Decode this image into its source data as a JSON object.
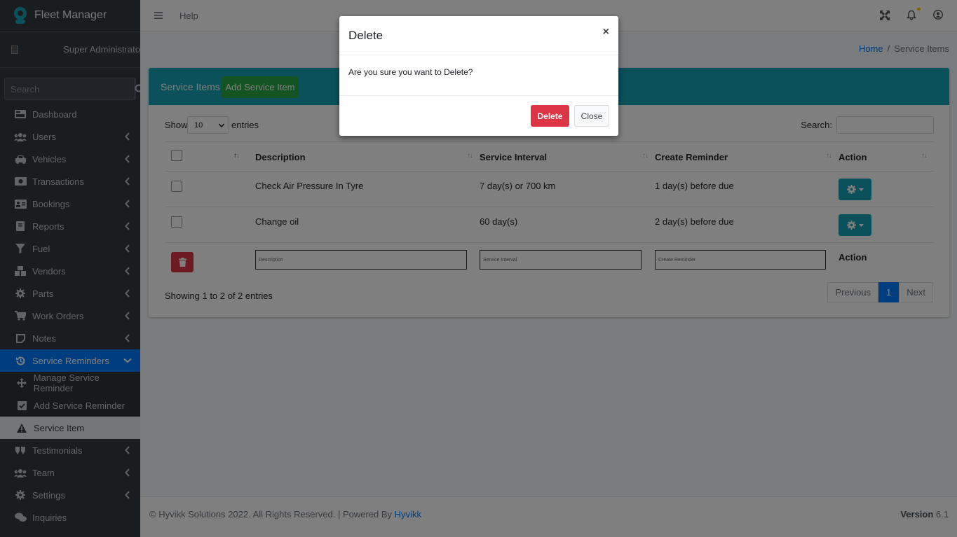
{
  "brand": {
    "title": "Fleet Manager"
  },
  "user": {
    "name": "Super Administrato",
    "avatar_alt": ""
  },
  "sidebar": {
    "search_placeholder": "Search",
    "items": [
      {
        "label": "Dashboard",
        "icon": "dashboard-icon"
      },
      {
        "label": "Users",
        "icon": "users-icon"
      },
      {
        "label": "Vehicles",
        "icon": "car-icon"
      },
      {
        "label": "Transactions",
        "icon": "money-icon"
      },
      {
        "label": "Bookings",
        "icon": "address-card-icon"
      },
      {
        "label": "Reports",
        "icon": "book-icon"
      },
      {
        "label": "Fuel",
        "icon": "filter-icon"
      },
      {
        "label": "Vendors",
        "icon": "cubes-icon"
      },
      {
        "label": "Parts",
        "icon": "gear-icon"
      },
      {
        "label": "Work Orders",
        "icon": "cart-icon"
      },
      {
        "label": "Notes",
        "icon": "note-icon"
      },
      {
        "label": "Service Reminders",
        "icon": "history-icon"
      },
      {
        "label": "Testimonials",
        "icon": "quote-icon"
      },
      {
        "label": "Team",
        "icon": "users-icon"
      },
      {
        "label": "Settings",
        "icon": "gear-icon"
      },
      {
        "label": "Inquiries",
        "icon": "comments-icon"
      }
    ],
    "sub_items": [
      {
        "label": "Manage Service Reminder",
        "icon": "arrows-icon"
      },
      {
        "label": "Add Service Reminder",
        "icon": "check-square-icon"
      },
      {
        "label": "Service Item",
        "icon": "warning-icon"
      }
    ],
    "active_color": "#007bff"
  },
  "topbar": {
    "help": "Help"
  },
  "breadcrumb": {
    "home": "Home",
    "separator": "/",
    "current": "Service Items"
  },
  "card": {
    "title": "Service Items",
    "add_button": "Add Service Item",
    "show_label": "Show",
    "show_value": "10",
    "entries_label": "entries",
    "search_label": "Search:",
    "columns": [
      "",
      "Description",
      "Service Interval",
      "Create Reminder",
      "Action"
    ],
    "rows": [
      {
        "description": "Check Air Pressure In Tyre",
        "interval": "7 day(s) or 700 km",
        "reminder": "1 day(s) before due"
      },
      {
        "description": "Change oil",
        "interval": "60 day(s)",
        "reminder": "2 day(s) before due"
      }
    ],
    "filters": {
      "description": "Description",
      "interval": "Service Interval",
      "reminder": "Create Reminder",
      "action": "Action"
    },
    "info": "Showing 1 to 2 of 2 entries",
    "pager": {
      "prev": "Previous",
      "page": "1",
      "next": "Next"
    },
    "header_color": "#17a2b8"
  },
  "footer": {
    "copyright": "© Hyvikk Solutions 2022. All Rights Reserved. | Powered By ",
    "link": "Hyvikk",
    "version_label": "Version",
    "version": "6.1"
  },
  "modal": {
    "title": "Delete",
    "close_symbol": "×",
    "body": "Are you sure you want to Delete?",
    "delete_button": "Delete",
    "close_button": "Close"
  }
}
